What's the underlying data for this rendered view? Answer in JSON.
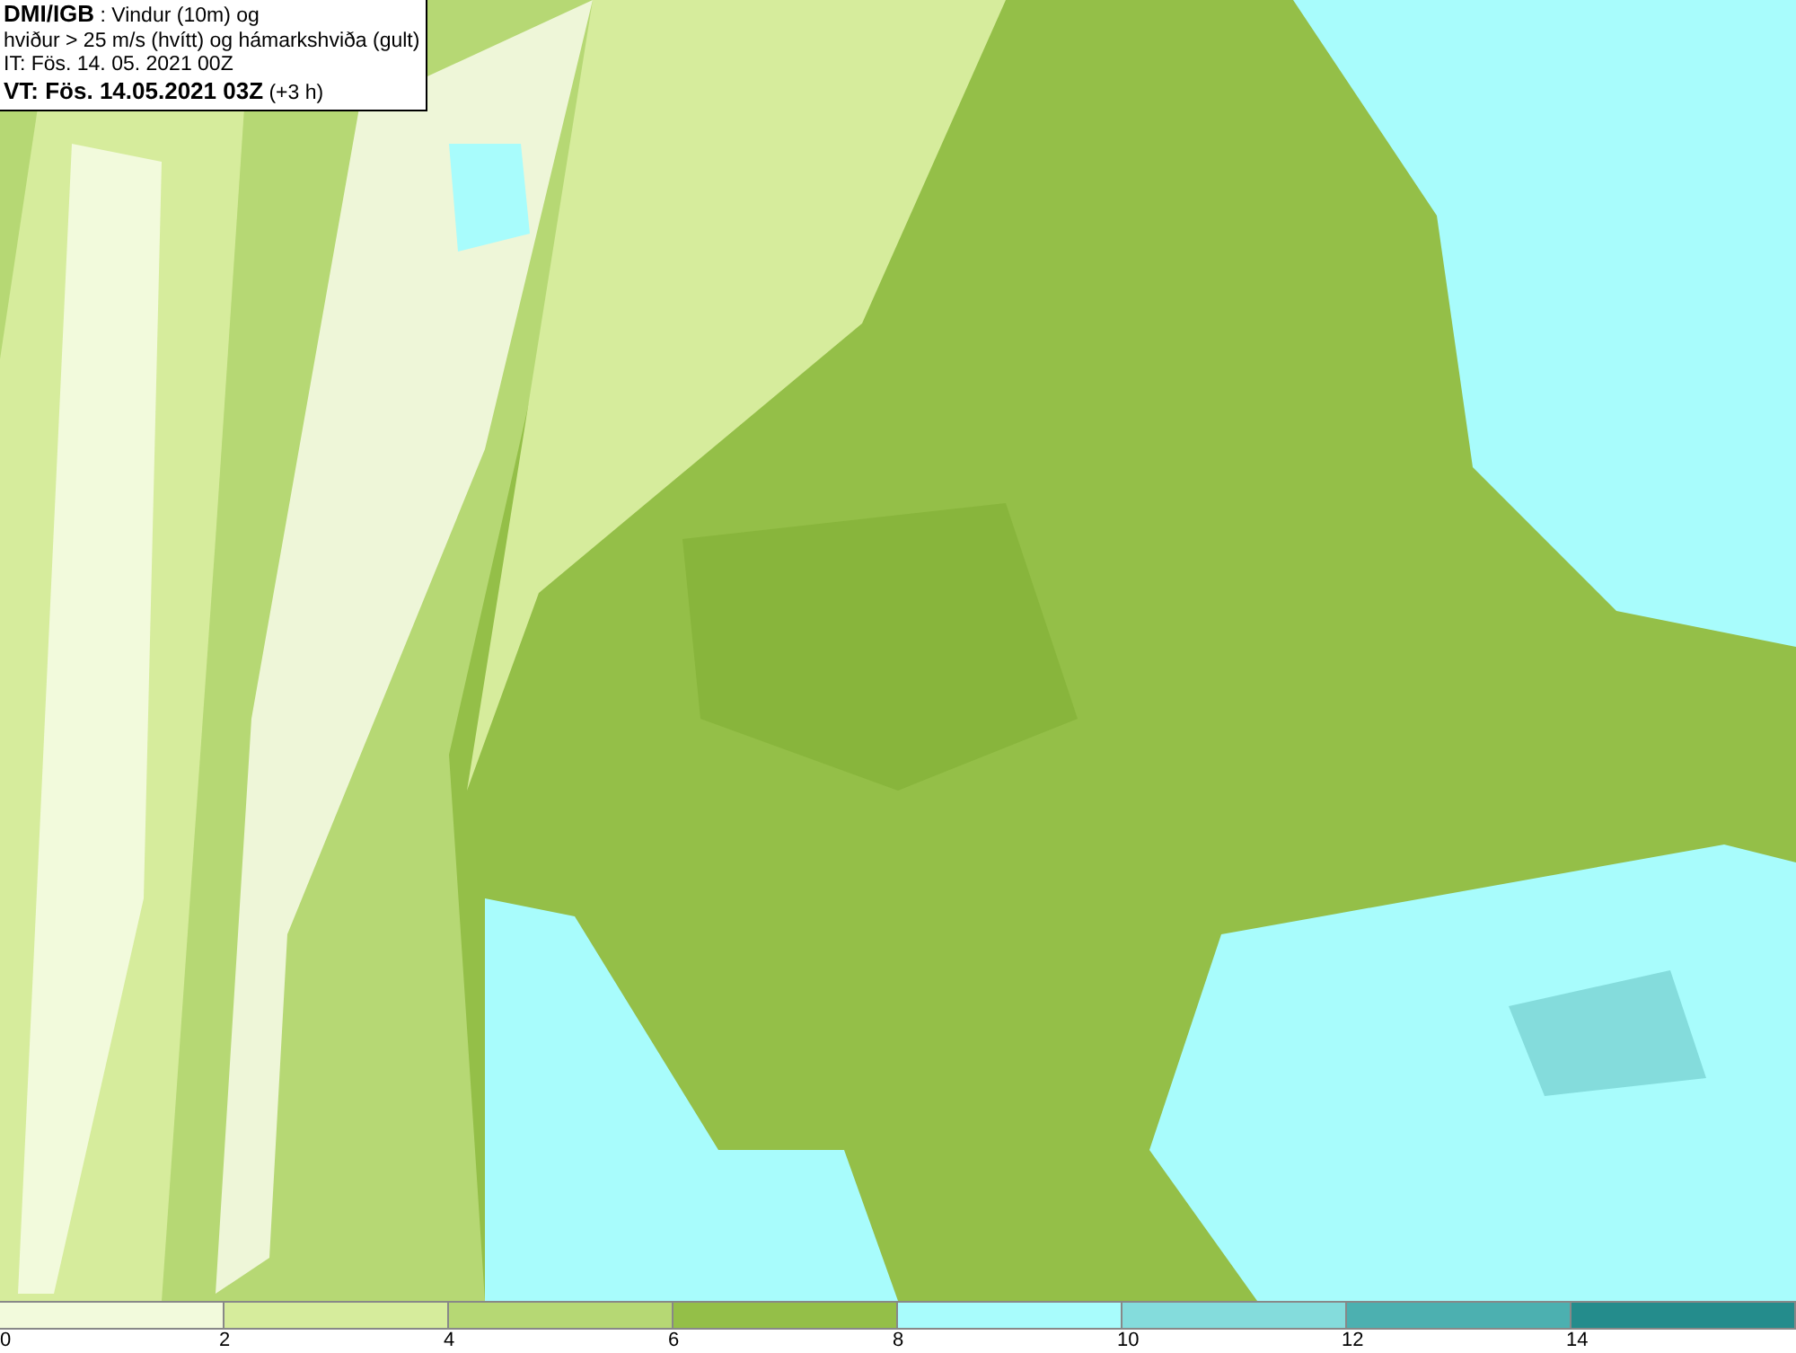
{
  "info_box": {
    "lines": [
      "**DMI/IGB** : Vindur (10m) og",
      "hviður > 25 m/s (hvítt) og hámarkshviða (gult)",
      "IT: Fös. 14. 05. 2021 00Z",
      "**VT: Fös. 14.05.2021 03Z** (+3 h)"
    ]
  },
  "legend": {
    "swatches": [
      {
        "color": "#f2fadc"
      },
      {
        "color": "#d6ec9c"
      },
      {
        "color": "#b6d874"
      },
      {
        "color": "#94bf48"
      },
      {
        "color": "#a8fcfc"
      },
      {
        "color": "#84dcdc"
      },
      {
        "color": "#4cb0b0"
      },
      {
        "color": "#248c8c"
      }
    ],
    "ticks": [
      "0",
      "2",
      "4",
      "6",
      "8",
      "10",
      "12",
      "14"
    ]
  }
}
